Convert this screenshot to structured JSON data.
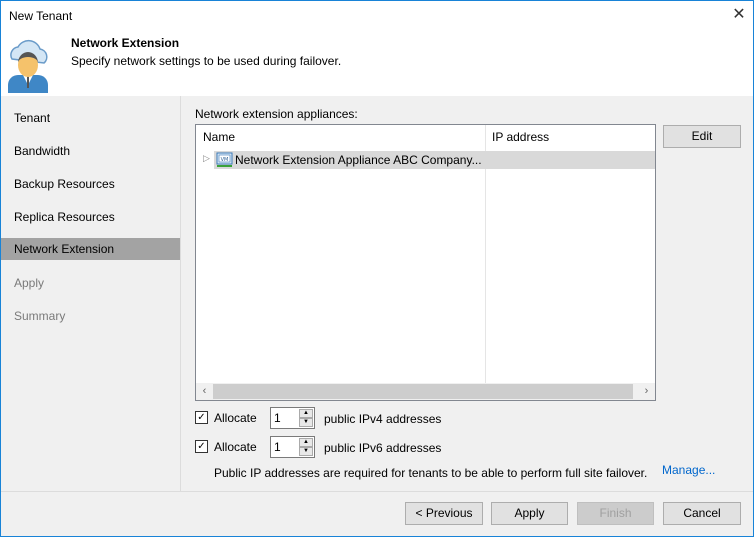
{
  "window": {
    "title": "New Tenant"
  },
  "header": {
    "title": "Network Extension",
    "subtitle": "Specify network settings to be used during failover."
  },
  "nav": {
    "items": [
      {
        "label": "Tenant",
        "state": "normal"
      },
      {
        "label": "Bandwidth",
        "state": "normal"
      },
      {
        "label": "Backup Resources",
        "state": "normal"
      },
      {
        "label": "Replica Resources",
        "state": "normal"
      },
      {
        "label": "Network Extension",
        "state": "selected"
      },
      {
        "label": "Apply",
        "state": "disabled"
      },
      {
        "label": "Summary",
        "state": "disabled"
      }
    ]
  },
  "main": {
    "list_label": "Network extension appliances:",
    "columns": [
      "Name",
      "IP address"
    ],
    "rows": [
      {
        "name": "Network Extension Appliance ABC Company...",
        "ip": ""
      }
    ],
    "edit_label": "Edit",
    "ipv4": {
      "checked": true,
      "label": "Allocate",
      "value": "1",
      "suffix": "public IPv4 addresses"
    },
    "ipv6": {
      "checked": true,
      "label": "Allocate",
      "value": "1",
      "suffix": "public IPv6 addresses"
    },
    "note": "Public IP addresses are required for tenants to be able to perform full site failover.",
    "manage_label": "Manage..."
  },
  "footer": {
    "previous": "< Previous",
    "apply": "Apply",
    "finish": "Finish",
    "cancel": "Cancel"
  }
}
